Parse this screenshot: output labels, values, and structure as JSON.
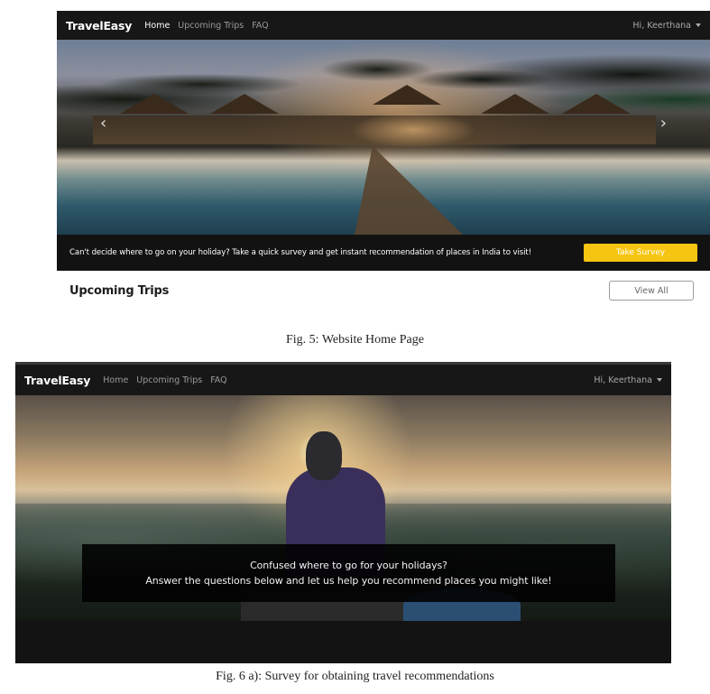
{
  "figure1": {
    "navbar": {
      "brand": "TravelEasy",
      "links": [
        "Home",
        "Upcoming Trips",
        "FAQ"
      ],
      "active_index": 0,
      "user_menu": "Hi, Keerthana"
    },
    "carousel": {
      "prev_icon": "chevron-left-icon",
      "next_icon": "chevron-right-icon",
      "prev_glyph": "‹",
      "next_glyph": "›"
    },
    "survey_bar": {
      "text": "Can't decide where to go on your holiday? Take a quick survey and get instant recommendation of places in India to visit!",
      "button_label": "Take Survey",
      "button_color": "#f6c512"
    },
    "upcoming": {
      "title": "Upcoming Trips",
      "view_all_label": "View All"
    },
    "caption": "Fig. 5: Website Home Page"
  },
  "figure2": {
    "navbar": {
      "brand": "TravelEasy",
      "links": [
        "Home",
        "Upcoming Trips",
        "FAQ"
      ],
      "user_menu": "Hi, Keerthana"
    },
    "overlay": {
      "line1": "Confused where to go for your holidays?",
      "line2": "Answer the questions below and let us help you recommend places you might like!"
    },
    "caption": "Fig. 6 a): Survey for obtaining travel recommendations"
  }
}
